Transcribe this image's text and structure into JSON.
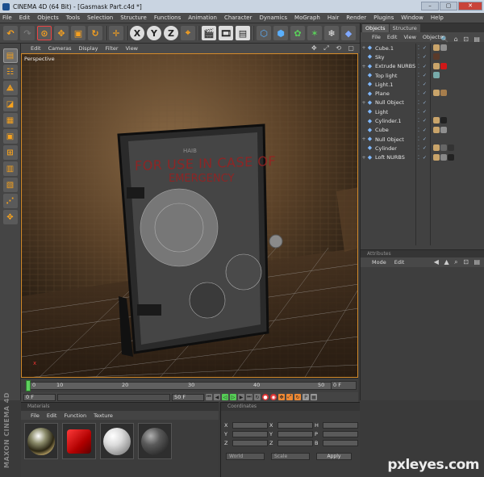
{
  "window": {
    "title": "CINEMA 4D (64 Bit) - [Gasmask Part.c4d *]",
    "controls": [
      "–",
      "▢",
      "✕"
    ]
  },
  "menubar": [
    "File",
    "Edit",
    "Objects",
    "Tools",
    "Selection",
    "Structure",
    "Functions",
    "Animation",
    "Character",
    "Dynamics",
    "MoGraph",
    "Hair",
    "Render",
    "Plugins",
    "Window",
    "Help"
  ],
  "viewport": {
    "menu": [
      "Edit",
      "Cameras",
      "Display",
      "Filter",
      "View"
    ],
    "label": "Perspective",
    "nav_icons": "✥ ⤢ ⟲ ▢",
    "scene_text_line1": "FOR USE IN CASE OF",
    "scene_text_line2": "EMERGENCY",
    "scene_text_small": "HAIB",
    "axis_label": "x"
  },
  "timeline": {
    "ticks": [
      "0",
      "10",
      "20",
      "30",
      "40",
      "50"
    ],
    "frame": "0 F"
  },
  "transport": {
    "start": "0 F",
    "end": "50 F"
  },
  "materials": {
    "header": "Materials",
    "menu": [
      "File",
      "Edit",
      "Function",
      "Texture"
    ]
  },
  "coordinates": {
    "header": "Coordinates",
    "col1": [
      "X",
      "Y",
      "Z"
    ],
    "col2": [
      "X",
      "Y",
      "Z"
    ],
    "col3": [
      "H",
      "P",
      "B"
    ],
    "mode1": "World",
    "mode2": "Scale",
    "apply": "Apply"
  },
  "object_manager": {
    "tabs": [
      "Objects",
      "Structure"
    ],
    "menu": [
      "File",
      "Edit",
      "View",
      "Objects"
    ],
    "icons": "🔍 ⌂ ⊡ ▤",
    "objects": [
      {
        "name": "Cube.1",
        "expand": "+",
        "tags": [
          "#c9a46a",
          "#8f8f8f"
        ]
      },
      {
        "name": "Sky",
        "expand": "",
        "tags": [
          "#5a3a2a"
        ]
      },
      {
        "name": "Extrude NURBS",
        "expand": "+",
        "tags": [
          "#c9a46a",
          "#d01818"
        ]
      },
      {
        "name": "Top light",
        "expand": "",
        "tags": [
          "#7aa"
        ]
      },
      {
        "name": "Light.1",
        "expand": "",
        "tags": []
      },
      {
        "name": "Plane",
        "expand": "",
        "tags": [
          "#c9a46a",
          "#a67d4c"
        ]
      },
      {
        "name": "Null Object",
        "expand": "+",
        "tags": []
      },
      {
        "name": "Light",
        "expand": "",
        "tags": []
      },
      {
        "name": "Cylinder.1",
        "expand": "",
        "tags": [
          "#c9a46a",
          "#222"
        ]
      },
      {
        "name": "Cube",
        "expand": "",
        "tags": [
          "#c9a46a",
          "#8f8f8f"
        ]
      },
      {
        "name": "Null Object",
        "expand": "+",
        "tags": []
      },
      {
        "name": "Cylinder",
        "expand": "",
        "tags": [
          "#c9a46a",
          "#666",
          "#333"
        ]
      },
      {
        "name": "Loft NURBS",
        "expand": "+",
        "tags": [
          "#c9a46a",
          "#888",
          "#222"
        ]
      }
    ]
  },
  "attributes": {
    "header": "Attributes",
    "menu": [
      "Mode",
      "Edit"
    ],
    "icons": "◀ ▲ ⌕ ⊡ ▤"
  },
  "left_tools": [
    "▤",
    "☷",
    "⟁",
    "◪",
    "▦",
    "▣",
    "⊞",
    "▥",
    "▧",
    "⋰",
    "✥"
  ],
  "toolbar_icons": [
    "↶",
    "↷",
    "⊙",
    "✥",
    "▣",
    "↻",
    "✛",
    "X",
    "Y",
    "Z",
    "⌖",
    "🎬",
    "🎞",
    "▤",
    "⬡",
    "⬢",
    "✿",
    "✶",
    "❄",
    "◆"
  ],
  "brand": "MAXON CINEMA 4D",
  "watermark": "pxleyes.com"
}
